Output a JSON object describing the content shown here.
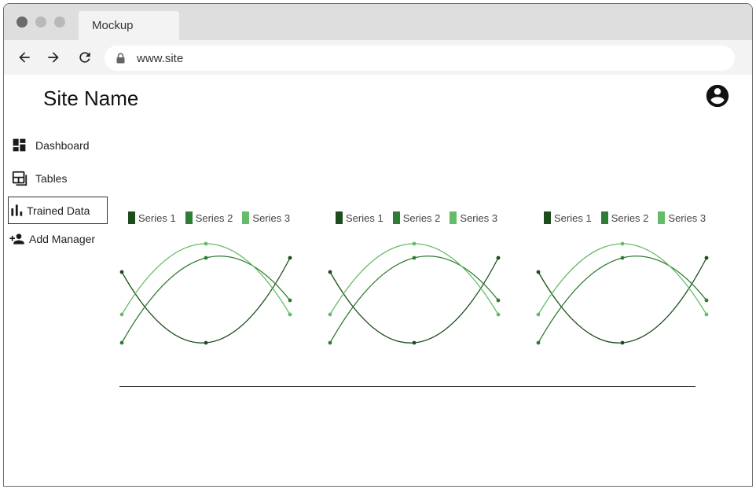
{
  "browser": {
    "tab_title": "Mockup",
    "url": "www.site"
  },
  "site": {
    "name": "Site Name"
  },
  "sidebar": {
    "items": [
      {
        "label": "Dashboard",
        "icon": "dashboard-icon",
        "active": false
      },
      {
        "label": "Tables",
        "icon": "tables-icon",
        "active": false
      },
      {
        "label": "Trained Data",
        "icon": "bar-chart-icon",
        "active": true
      },
      {
        "label": "Add Manager",
        "icon": "add-person-icon",
        "active": false
      }
    ]
  },
  "colors": {
    "series_1": "#1d4d1d",
    "series_2": "#2e7d32",
    "series_3": "#66bb6a",
    "axis": "#222222"
  },
  "chart_data": [
    {
      "type": "line",
      "x": [
        1,
        2,
        3
      ],
      "series": [
        {
          "name": "Series 1",
          "values": [
            50,
            0,
            60
          ]
        },
        {
          "name": "Series 2",
          "values": [
            0,
            60,
            30
          ]
        },
        {
          "name": "Series 3",
          "values": [
            20,
            70,
            20
          ]
        }
      ],
      "ylim": [
        0,
        70
      ],
      "grid": false,
      "legend": "top-left"
    },
    {
      "type": "line",
      "x": [
        1,
        2,
        3
      ],
      "series": [
        {
          "name": "Series 1",
          "values": [
            50,
            0,
            60
          ]
        },
        {
          "name": "Series 2",
          "values": [
            0,
            60,
            30
          ]
        },
        {
          "name": "Series 3",
          "values": [
            20,
            70,
            20
          ]
        }
      ],
      "ylim": [
        0,
        70
      ],
      "grid": false,
      "legend": "top-left"
    },
    {
      "type": "line",
      "x": [
        1,
        2,
        3
      ],
      "series": [
        {
          "name": "Series 1",
          "values": [
            50,
            0,
            60
          ]
        },
        {
          "name": "Series 2",
          "values": [
            0,
            60,
            30
          ]
        },
        {
          "name": "Series 3",
          "values": [
            20,
            70,
            20
          ]
        }
      ],
      "ylim": [
        0,
        70
      ],
      "grid": false,
      "legend": "top-left"
    }
  ]
}
